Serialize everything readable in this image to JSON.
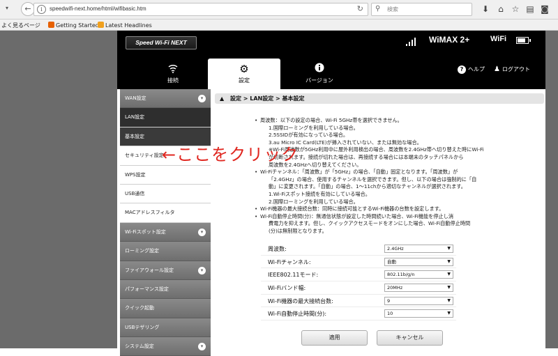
{
  "browser": {
    "url": "speedwifi-next.home/html/wifibasic.htm",
    "search_placeholder": "検索",
    "bookmarks": [
      "よく見るページ",
      "Getting Started",
      "Latest Headlines"
    ]
  },
  "header": {
    "brand": "Speed Wi-Fi NEXT",
    "network": "WiMAX 2+",
    "wifi": "WiFi",
    "battery_level": 0.85,
    "tabs": [
      {
        "label": "接続",
        "icon": "wifi-icon"
      },
      {
        "label": "設定",
        "icon": "gear-icon"
      },
      {
        "label": "バージョン",
        "icon": "info-icon"
      }
    ],
    "help": "ヘルプ",
    "logout": "ログアウト"
  },
  "menu": [
    {
      "label": "WAN設定",
      "kind": "cat",
      "expanded": true
    },
    {
      "label": "LAN設定",
      "kind": "sub",
      "state": "dark"
    },
    {
      "label": "基本設定",
      "kind": "sub",
      "state": "selected"
    },
    {
      "label": "セキュリティ設定",
      "kind": "sub"
    },
    {
      "label": "WPS設定",
      "kind": "sub"
    },
    {
      "label": "USB通信",
      "kind": "sub"
    },
    {
      "label": "MACアドレスフィルタ",
      "kind": "sub"
    },
    {
      "label": "Wi-Fiスポット設定",
      "kind": "cat",
      "expanded": true
    },
    {
      "label": "ローミング設定",
      "kind": "cat"
    },
    {
      "label": "ファイアウォール設定",
      "kind": "cat",
      "expanded": true
    },
    {
      "label": "パフォーマンス設定",
      "kind": "cat"
    },
    {
      "label": "クイック起動",
      "kind": "cat"
    },
    {
      "label": "USBテザリング",
      "kind": "cat"
    },
    {
      "label": "システム設定",
      "kind": "cat",
      "expanded": true
    }
  ],
  "breadcrumb": "設定 > LAN設定 > 基本設定",
  "notes": [
    {
      "text": "周波数：以下の設定の場合、Wi-Fi 5GHz帯を選択できません。",
      "bullet": true
    },
    {
      "text": "1.国際ローミングを利用している場合。",
      "bullet": false
    },
    {
      "text": "2.5SSIDが有効になっている場合。",
      "bullet": false
    },
    {
      "text": "3.au Micro IC Card(LTE)が挿入されていない、または無効な場合。",
      "bullet": false
    },
    {
      "text": "※Wi-Fi周波数が5GHz利用中に屋外利用検出の場合、周波数を2.4GHz帯へ切り替えた時にWi-Fi",
      "bullet": false
    },
    {
      "text": "が切断されます。接続が切れた場合は、再接続する場合には本端末のタッチパネルから",
      "bullet": false
    },
    {
      "text": "周波数を2.4GHzへ切り替えてください。",
      "bullet": false
    },
    {
      "text": "Wi-Fiチャンネル：「周波数」が「5GHz」の場合、「自動」固定となります。「周波数」が",
      "bullet": true
    },
    {
      "text": "「2.4GHz」の場合、使用するチャンネルを選択できます。但し、以下の場合は強制的に「自",
      "bullet": false
    },
    {
      "text": "動」に変更されます。「自動」の場合、1〜11chから適切なチャンネルが選択されます。",
      "bullet": false
    },
    {
      "text": "1.Wi-Fiスポット接続を有効にしている場合。",
      "bullet": false
    },
    {
      "text": "2.国際ローミングを利用している場合。",
      "bullet": false
    },
    {
      "text": "Wi-Fi機器の最大接続台数：同時に接続可能とするWi-Fi機器の台数を設定します。",
      "bullet": true
    },
    {
      "text": "Wi-Fi自動停止時間(分)：無通信状態が設定した時間続いた場合、Wi-Fi機能を停止し消",
      "bullet": true
    },
    {
      "text": "費電力を抑えます。但し、クイックアクセスモードをオンにした場合、Wi-Fi自動停止時間",
      "bullet": false
    },
    {
      "text": "(分)は無制限となります。",
      "bullet": false
    }
  ],
  "annotation": "←ここをクリック",
  "form": [
    {
      "label": "周波数:",
      "value": "2.4GHz"
    },
    {
      "label": "Wi-Fiチャンネル:",
      "value": "自動"
    },
    {
      "label": "IEEE802.11モード:",
      "value": "802.11b/g/n"
    },
    {
      "label": "Wi-Fiバンド幅:",
      "value": "20MHz"
    },
    {
      "label": "Wi-Fi機器の最大接続台数:",
      "value": "9"
    },
    {
      "label": "Wi-Fi自動停止時間(分):",
      "value": "10"
    }
  ],
  "buttons": {
    "apply": "適用",
    "cancel": "キャンセル"
  }
}
